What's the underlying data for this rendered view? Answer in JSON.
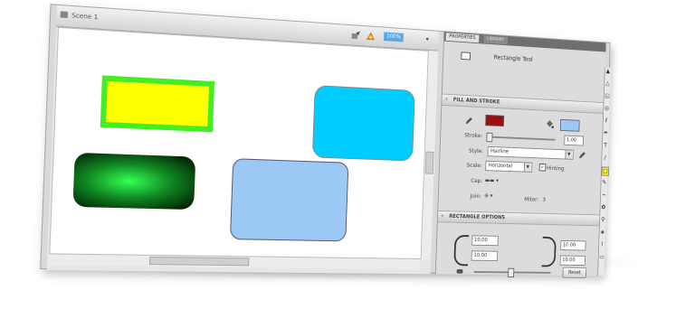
{
  "stage": {
    "title": "Scene 1",
    "zoom": "100%",
    "icons": [
      "scene-icon",
      "edit-scene-icon",
      "edit-symbol-icon"
    ]
  },
  "canvas_shapes": [
    {
      "name": "yellow-rectangle",
      "fill": "#ffff00",
      "stroke": "#44ee22"
    },
    {
      "name": "cyan-rounded-rectangle",
      "fill": "#00ccff",
      "stroke": "#888888"
    },
    {
      "name": "green-gradient-rounded-rectangle",
      "fill": "radial #33ff55 to #001800"
    },
    {
      "name": "light-blue-rounded-rectangle",
      "fill": "#9cc8f6",
      "stroke": "#555566"
    }
  ],
  "properties": {
    "tabs": [
      "PROPERTIES",
      "LIBRARY"
    ],
    "tool_name": "Rectangle Tool",
    "fill_and_stroke": {
      "header": "FILL AND STROKE",
      "stroke_color": "#9a1010",
      "fill_color": "#9cc8f6",
      "stroke_label": "Stroke:",
      "stroke_value": "1.00",
      "style_label": "Style:",
      "style_value": "Hairline",
      "scale_label": "Scale:",
      "scale_value": "Horizontal",
      "hinting_label": "Hinting",
      "hinting_checked": true,
      "cap_label": "Cap:",
      "join_label": "Join:",
      "miter_label": "Miter:",
      "miter_value": "3"
    },
    "rectangle_options": {
      "header": "RECTANGLE OPTIONS",
      "top_left": "10.00",
      "bottom_left": "10.00",
      "top_right": "10.00",
      "bottom_right": "10.00",
      "reset_label": "Reset"
    }
  },
  "toolbar": {
    "tools": [
      "selection-tool",
      "subselection-tool",
      "free-transform-tool",
      "3d-rotation-tool",
      "lasso-tool",
      "pen-tool",
      "text-tool",
      "line-tool",
      "rectangle-tool",
      "pencil-tool",
      "brush-tool",
      "deco-tool",
      "bone-tool",
      "paint-bucket-tool",
      "eyedropper-tool",
      "eraser-tool"
    ],
    "glyphs": [
      "▲",
      "△",
      "◱",
      "◎",
      "ℓ",
      "✒",
      "T",
      "/",
      "□",
      "✎",
      "⌁",
      "✿",
      "⚲",
      "◈",
      "⌇",
      "▭"
    ],
    "active_tool": "rectangle-tool"
  }
}
